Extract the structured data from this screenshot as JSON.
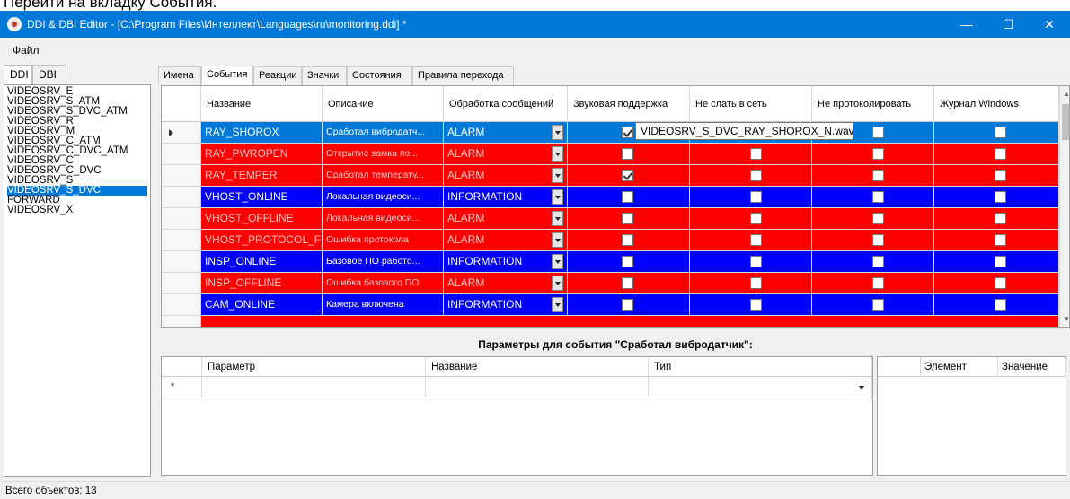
{
  "page_caption": "Перейти на вкладку События.",
  "window": {
    "title": "DDI & DBI Editor - [C:\\Program Files\\Интеллект\\Languages\\ru\\monitoring.ddi] *",
    "minimize_glyph": "—",
    "maximize_glyph": "☐",
    "close_glyph": "✕",
    "app_icon": "app-logo-icon"
  },
  "menu": {
    "file": "Файл"
  },
  "left_tabs": {
    "ddi": "DDI",
    "dbi": "DBI"
  },
  "object_list": [
    "VIDEOSRV_E",
    "VIDEOSRV_S_ATM",
    "VIDEOSRV_S_DVC_ATM",
    "VIDEOSRV_R",
    "VIDEOSRV_M",
    "VIDEOSRV_C_ATM",
    "VIDEOSRV_C_DVC_ATM",
    "VIDEOSRV_C",
    "VIDEOSRV_C_DVC",
    "VIDEOSRV_S",
    "VIDEOSRV_S_DVC",
    "FORWARD",
    "VIDEOSRV_X"
  ],
  "object_list_selected": "VIDEOSRV_S_DVC",
  "right_tabs": [
    "Имена",
    "События",
    "Реакции",
    "Значки",
    "Состояния",
    "Правила перехода"
  ],
  "right_tabs_active": "События",
  "events_grid": {
    "headers": {
      "name": "Название",
      "description": "Описание",
      "processing": "Обработка сообщений",
      "sound": "Звуковая поддержка",
      "no_send": "Не слать в сеть",
      "no_log": "Не протоколировать",
      "winlog": "Журнал Windows"
    },
    "rows": [
      {
        "name": "RAY_SHOROX",
        "description": "Сработал вибродатч...",
        "processing": "ALARM",
        "sound": true,
        "no_send": false,
        "no_log": false,
        "winlog": false,
        "color": "selected"
      },
      {
        "name": "RAY_PWROPEN",
        "description": "Открытие замка по...",
        "processing": "ALARM",
        "sound": false,
        "no_send": false,
        "no_log": false,
        "winlog": false,
        "color": "red"
      },
      {
        "name": "RAY_TEMPER",
        "description": "Сработал температу...",
        "processing": "ALARM",
        "sound": true,
        "no_send": false,
        "no_log": false,
        "winlog": false,
        "color": "red"
      },
      {
        "name": "VHOST_ONLINE",
        "description": "Локальная видеоси...",
        "processing": "INFORMATION",
        "sound": false,
        "no_send": false,
        "no_log": false,
        "winlog": false,
        "color": "blue"
      },
      {
        "name": "VHOST_OFFLINE",
        "description": "Локальная видеоси...",
        "processing": "ALARM",
        "sound": false,
        "no_send": false,
        "no_log": false,
        "winlog": false,
        "color": "red"
      },
      {
        "name": "VHOST_PROTOCOL_F",
        "description": "Ошибка протокола",
        "processing": "ALARM",
        "sound": false,
        "no_send": false,
        "no_log": false,
        "winlog": false,
        "color": "red"
      },
      {
        "name": "INSP_ONLINE",
        "description": "Базовое ПО работо...",
        "processing": "INFORMATION",
        "sound": false,
        "no_send": false,
        "no_log": false,
        "winlog": false,
        "color": "blue"
      },
      {
        "name": "INSP_OFFLINE",
        "description": "Ошибка базового ПО",
        "processing": "ALARM",
        "sound": false,
        "no_send": false,
        "no_log": false,
        "winlog": false,
        "color": "red"
      },
      {
        "name": "CAM_ONLINE",
        "description": "Камера включена",
        "processing": "INFORMATION",
        "sound": false,
        "no_send": false,
        "no_log": false,
        "winlog": false,
        "color": "blue"
      }
    ],
    "tooltip": "VIDEOSRV_S_DVC_RAY_SHOROX_N.wav"
  },
  "params_title": "Параметры для события \"Сработал вибродатчик\":",
  "params_grid": {
    "headers": {
      "param": "Параметр",
      "name": "Название",
      "type": "Тип"
    },
    "new_row_marker": "*"
  },
  "elements_grid": {
    "headers": {
      "element": "Элемент",
      "value": "Значение"
    }
  },
  "status": "Всего объектов: 13",
  "colors": {
    "title_bar": "#0078d7",
    "row_red": "#ff0000",
    "row_blue": "#0000ff",
    "row_selected": "#0078d7"
  }
}
